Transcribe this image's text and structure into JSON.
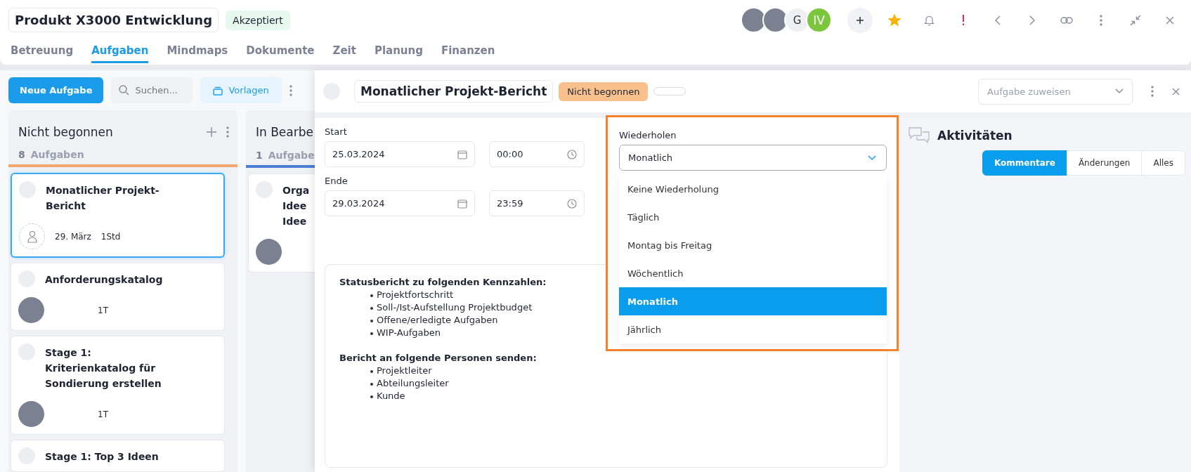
{
  "header": {
    "project_title": "Produkt X3000 Entwicklung",
    "status_badge": "Akzeptiert",
    "members": [
      {
        "kind": "photo"
      },
      {
        "kind": "photo"
      },
      {
        "kind": "initials",
        "initials": "G",
        "color": "#eef0f4"
      },
      {
        "kind": "initials",
        "initials": "IV",
        "color": "#7cc63e"
      }
    ],
    "favorite": true
  },
  "tabs": [
    {
      "label": "Betreuung",
      "selected": false
    },
    {
      "label": "Aufgaben",
      "selected": true
    },
    {
      "label": "Mindmaps",
      "selected": false
    },
    {
      "label": "Dokumente",
      "selected": false
    },
    {
      "label": "Zeit",
      "selected": false
    },
    {
      "label": "Planung",
      "selected": false
    },
    {
      "label": "Finanzen",
      "selected": false
    }
  ],
  "board": {
    "new_task_button": "Neue Aufgabe",
    "search": {
      "placeholder": "Suchen..."
    },
    "templates_button": "Vorlagen",
    "columns": [
      {
        "title": "Nicht begonnen",
        "count": "8",
        "count_label": "Aufgaben",
        "color": "#f5a66e",
        "cards": [
          {
            "title": "Monatlicher Projekt-Bericht",
            "selected": true,
            "assignee": {
              "kind": "unassigned"
            },
            "due": "29. März",
            "duration": "1Std"
          },
          {
            "title": "Anforderungskatalog",
            "selected": false,
            "assignee": {
              "kind": "photo"
            },
            "duration": "1T"
          },
          {
            "title": "Stage 1: Kriterienkatalog für Sondierung erstellen",
            "selected": false,
            "assignee": {
              "kind": "photo"
            },
            "duration": "1T"
          },
          {
            "title": "Stage 1: Top 3 Ideen",
            "selected": false
          }
        ]
      },
      {
        "title": "In Bearbe",
        "count": "1",
        "count_label": "Aufgabe",
        "color": "#4a7fd4",
        "cards": [
          {
            "title": "Orga Idee Idee",
            "selected": false,
            "assignee": {
              "kind": "photo"
            }
          }
        ]
      }
    ]
  },
  "task": {
    "title": "Monatlicher Projekt-Bericht",
    "status": "Nicht begonnen",
    "assign": {
      "placeholder": "Aufgabe zuweisen"
    },
    "start_label": "Start",
    "start_date": "25.03.2024",
    "start_time": "00:00",
    "end_label": "Ende",
    "end_date": "29.03.2024",
    "end_time": "23:59",
    "repeat": {
      "label": "Wiederholen",
      "value": "Monatlich",
      "expanded": true,
      "options": [
        {
          "label": "Keine Wiederholung",
          "selected": false
        },
        {
          "label": "Täglich",
          "selected": false
        },
        {
          "label": "Montag bis Freitag",
          "selected": false
        },
        {
          "label": "Wöchentlich",
          "selected": false
        },
        {
          "label": "Monatlich",
          "selected": true
        },
        {
          "label": "Jährlich",
          "selected": false
        }
      ]
    },
    "description": [
      {
        "heading": "Statusbericht zu folgenden Kennzahlen:",
        "items": [
          "Projektfortschritt",
          "Soll-/Ist-Aufstellung Projektbudget",
          "Offene/erledigte Aufgaben",
          "WIP-Aufgaben"
        ]
      },
      {
        "heading": "Bericht an folgende Personen senden:",
        "items": [
          "Projektleiter",
          "Abteilungsleiter",
          "Kunde"
        ]
      }
    ]
  },
  "activity": {
    "title": "Aktivitäten",
    "tabs": [
      {
        "label": "Kommentare",
        "selected": true
      },
      {
        "label": "Änderungen",
        "selected": false
      },
      {
        "label": "Alles",
        "selected": false
      }
    ]
  }
}
